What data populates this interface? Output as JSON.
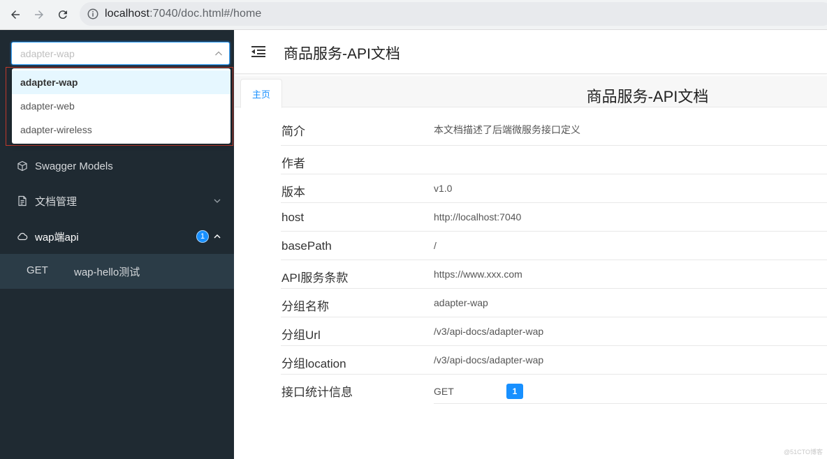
{
  "browser": {
    "url_host": "localhost",
    "url_rest": ":7040/doc.html#/home"
  },
  "sidebar": {
    "group_select": {
      "placeholder": "adapter-wap",
      "options": [
        "adapter-wap",
        "adapter-web",
        "adapter-wireless"
      ],
      "active": "adapter-wap"
    },
    "menu": [
      {
        "label": "Swagger Models",
        "icon": "cube-icon"
      },
      {
        "label": "文档管理",
        "icon": "document-icon"
      },
      {
        "label": "wap端api",
        "icon": "cloud-icon",
        "badge": "1"
      }
    ],
    "submenu": {
      "method": "GET",
      "name": "wap-hello测试"
    }
  },
  "header": {
    "title": "商品服务-API文档"
  },
  "tabs": [
    {
      "label": "主页"
    }
  ],
  "doc": {
    "title": "商品服务-API文档",
    "rows": [
      {
        "key": "简介",
        "value": "本文档描述了后端微服务接口定义"
      },
      {
        "key": "作者",
        "value": ""
      },
      {
        "key": "版本",
        "value": "v1.0"
      },
      {
        "key": "host",
        "value": "http://localhost:7040"
      },
      {
        "key": "basePath",
        "value": "/"
      },
      {
        "key": "API服务条款",
        "value": "https://www.xxx.com"
      },
      {
        "key": "分组名称",
        "value": "adapter-wap"
      },
      {
        "key": "分组Url",
        "value": "/v3/api-docs/adapter-wap"
      },
      {
        "key": "分组location",
        "value": "/v3/api-docs/adapter-wap"
      }
    ],
    "stats": {
      "key": "接口统计信息",
      "method": "GET",
      "count": "1"
    }
  },
  "watermark": "@51CTO博客",
  "colors": {
    "accent": "#1890ff",
    "sidebar_bg": "#1f2a32"
  }
}
